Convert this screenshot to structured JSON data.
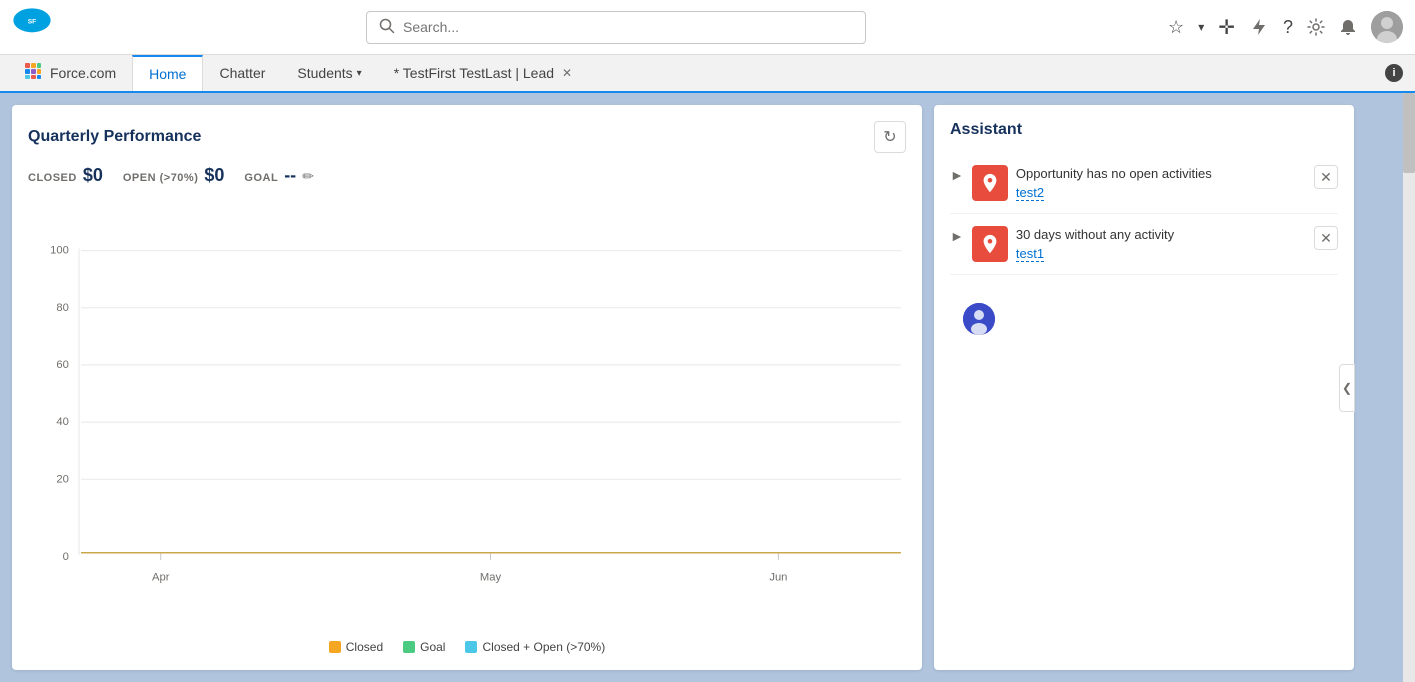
{
  "topNav": {
    "searchPlaceholder": "Search...",
    "appName": "Force.com"
  },
  "tabs": [
    {
      "id": "home",
      "label": "Home",
      "active": true,
      "closeable": false
    },
    {
      "id": "chatter",
      "label": "Chatter",
      "active": false,
      "closeable": false
    },
    {
      "id": "students",
      "label": "Students",
      "active": false,
      "closeable": false,
      "hasMore": true
    },
    {
      "id": "dynamic",
      "label": "* TestFirst TestLast | Lead",
      "active": false,
      "closeable": true
    }
  ],
  "performanceCard": {
    "title": "Quarterly Performance",
    "stats": {
      "closedLabel": "CLOSED",
      "closedValue": "$0",
      "openLabel": "OPEN (>70%)",
      "openValue": "$0",
      "goalLabel": "GOAL",
      "goalValue": "--"
    },
    "chart": {
      "yLabels": [
        "100",
        "80",
        "60",
        "40",
        "20",
        "0"
      ],
      "xLabels": [
        "Apr",
        "May",
        "Jun"
      ]
    },
    "legend": [
      {
        "id": "closed",
        "label": "Closed",
        "color": "#f5a623"
      },
      {
        "id": "goal",
        "label": "Goal",
        "color": "#4bca81"
      },
      {
        "id": "closed-open",
        "label": "Closed + Open (>70%)",
        "color": "#4bc7e8"
      }
    ]
  },
  "assistant": {
    "title": "Assistant",
    "items": [
      {
        "id": "item1",
        "message": "Opportunity has no open activities",
        "linkText": "test2"
      },
      {
        "id": "item2",
        "message": "30 days without any activity",
        "linkText": "test1"
      }
    ]
  }
}
